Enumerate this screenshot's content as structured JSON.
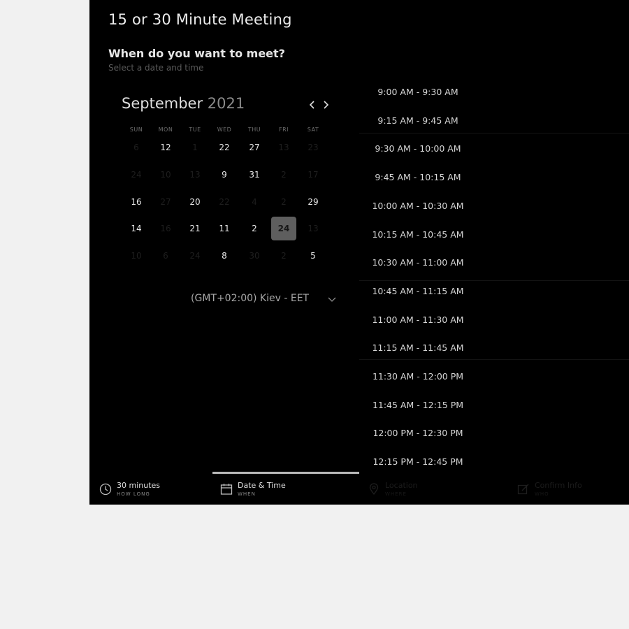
{
  "meeting": {
    "title": "15 or 30 Minute Meeting",
    "question": "When do you want to meet?",
    "subtext": "Select a date and time"
  },
  "calendar": {
    "month": "September",
    "year": "2021",
    "weekdays": [
      "SUN",
      "MON",
      "TUE",
      "WED",
      "THU",
      "FRI",
      "SAT"
    ],
    "weeks": [
      [
        "6",
        "12",
        "1",
        "22",
        "27",
        "13",
        "23"
      ],
      [
        "24",
        "10",
        "13",
        "9",
        "31",
        "2",
        "17"
      ],
      [
        "16",
        "27",
        "20",
        "22",
        "4",
        "2",
        "29"
      ],
      [
        "14",
        "16",
        "21",
        "11",
        "2",
        "24",
        "13"
      ],
      [
        "10",
        "6",
        "24",
        "8",
        "30",
        "2",
        "5"
      ]
    ],
    "available": [
      [
        false,
        true,
        false,
        true,
        true,
        false,
        false
      ],
      [
        false,
        false,
        false,
        true,
        true,
        false,
        false
      ],
      [
        true,
        false,
        true,
        false,
        false,
        false,
        true
      ],
      [
        true,
        false,
        true,
        true,
        true,
        true,
        false
      ],
      [
        false,
        false,
        false,
        true,
        false,
        false,
        true
      ]
    ],
    "selected": "24",
    "prev_icon": "chevron-left-icon",
    "next_icon": "chevron-right-icon"
  },
  "timezone": {
    "label": "(GMT+02:00) Kiev - EET",
    "icon": "chevron-down-icon"
  },
  "slots": [
    "9:00 AM - 9:30 AM",
    "9:15 AM - 9:45 AM",
    "9:30 AM - 10:00 AM",
    "9:45 AM - 10:15 AM",
    "10:00 AM - 10:30 AM",
    "10:15 AM - 10:45 AM",
    "10:30 AM - 11:00 AM",
    "10:45 AM - 11:15 AM",
    "11:00 AM - 11:30 AM",
    "11:15 AM - 11:45 AM",
    "11:30 AM - 12:00 PM",
    "11:45 AM - 12:15 PM",
    "12:00 PM - 12:30 PM",
    "12:15 PM - 12:45 PM"
  ],
  "steps": [
    {
      "label": "30 minutes",
      "sub": "HOW LONG",
      "icon": "clock-icon",
      "state": "done"
    },
    {
      "label": "Date & Time",
      "sub": "WHEN",
      "icon": "calendar-icon",
      "state": "active"
    },
    {
      "label": "Location",
      "sub": "WHERE",
      "icon": "map-pin-icon",
      "state": "upcoming"
    },
    {
      "label": "Confirm Info",
      "sub": "WHO",
      "icon": "edit-icon",
      "state": "upcoming"
    }
  ],
  "colors": {
    "page_background": "#f1f1f1",
    "panel_background": "#000000",
    "selected_day": "#5e5e5e",
    "active_tab_indicator": "#b8b8b8"
  }
}
